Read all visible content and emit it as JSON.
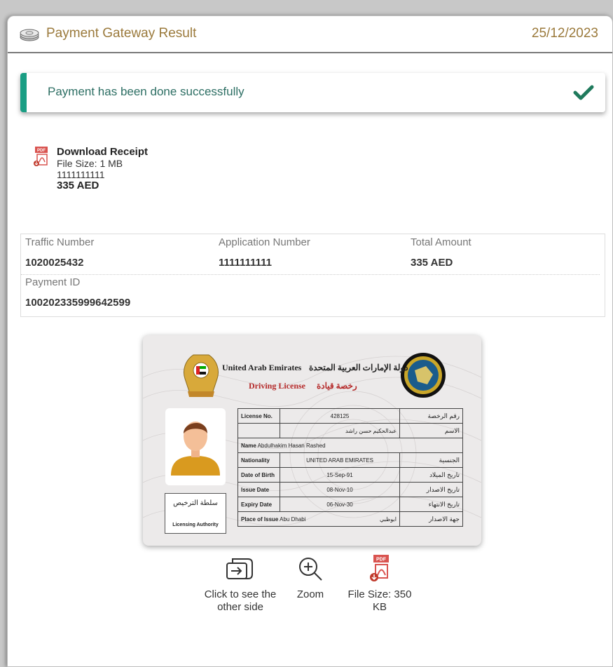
{
  "header": {
    "title": "Payment Gateway Result",
    "date": "25/12/2023",
    "icon": "money-stack-icon"
  },
  "alert": {
    "message": "Payment has been done successfully",
    "icon": "checkmark-icon",
    "accent": "#1a9e84"
  },
  "receipt": {
    "title": "Download Receipt",
    "file_size": "File Size: 1 MB",
    "number": "1111111111",
    "amount": "335 AED",
    "icon": "pdf-icon"
  },
  "details": {
    "traffic_label": "Traffic Number",
    "traffic_value": "1020025432",
    "application_label": "Application Number",
    "application_value": "1111111111",
    "total_label": "Total Amount",
    "total_value": "335 AED",
    "payment_label": "Payment ID",
    "payment_value": "100202335999642599"
  },
  "license": {
    "country_en": "United Arab Emirates",
    "country_ar": "دولة الإمارات العربية المتحدة",
    "title_en": "Driving License",
    "title_ar": "رخصة قيادة",
    "rows": [
      {
        "key": "License No.",
        "value": "428125",
        "key_ar": "رقم الرخصة"
      },
      {
        "key": "",
        "value": "عبدالحكيم حسن راشد",
        "key_ar": "الاسم"
      },
      {
        "key": "Name",
        "value": "Abdulhakim Hasan Rashed",
        "key_ar": ""
      },
      {
        "key": "Nationality",
        "value": "UNITED ARAB EMIRATES",
        "key_ar": "الجنسية"
      },
      {
        "key": "Date of Birth",
        "value": "15-Sep-91",
        "key_ar": "تاريخ الميلاد"
      },
      {
        "key": "Issue Date",
        "value": "08-Nov-10",
        "key_ar": "تاريخ الاصدار"
      },
      {
        "key": "Expiry Date",
        "value": "06-Nov-30",
        "key_ar": "تاريخ الانتهاء"
      },
      {
        "key": "Place of Issue",
        "value": "Abu Dhabi",
        "value_ar": "ابوظبي",
        "key_ar": "جهة الاصدار"
      }
    ],
    "authority_ar": "سلطة الترخيص",
    "authority_en": "Licensing Authority"
  },
  "tools": {
    "flip_label": "Click to see the other side",
    "zoom_label": "Zoom",
    "file_label": "File Size: 350 KB",
    "flip_icon": "flip-card-icon",
    "zoom_icon": "zoom-in-icon",
    "pdf_icon": "pdf-icon"
  }
}
